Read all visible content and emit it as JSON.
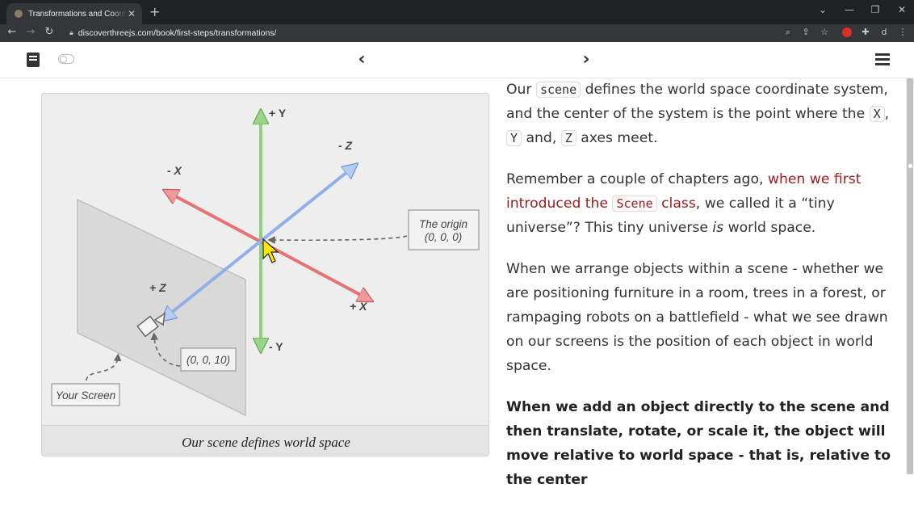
{
  "browser": {
    "tab_title": "Transformations and Coordinate",
    "tab_close": "✕",
    "new_tab": "+",
    "url": "discoverthreejs.com/book/first-steps/transformations/",
    "win_controls": {
      "list": "⌄",
      "minimize": "—",
      "restore": "❐",
      "close": "✕"
    },
    "profile_letter": "d"
  },
  "figure": {
    "labels": {
      "plus_y": "+ Y",
      "minus_y": "- Y",
      "plus_x": "+ X",
      "minus_x": "- X",
      "plus_z": "+ Z",
      "minus_z": "- Z"
    },
    "origin_label": [
      "The origin",
      "(0, 0, 0)"
    ],
    "camera_label": "(0, 0, 10)",
    "screen_label": "Your Screen",
    "caption": "Our scene defines world space",
    "colors": {
      "y_axis": "#8fd07a",
      "x_axis": "#e57373",
      "z_axis": "#8fb0e8"
    }
  },
  "content": {
    "p1": {
      "t1": "Our ",
      "c1": "scene",
      "t2": " defines the world space coordinate system, and the center of the system is the point where the ",
      "c2": "X",
      "t3": ", ",
      "c3": "Y",
      "t4": " and, ",
      "c4": "Z",
      "t5": " axes meet."
    },
    "p2": {
      "t1": "Remember a couple of chapters ago, ",
      "link1": "when we first introduced the ",
      "code": "Scene",
      "link2": " class",
      "t2": ", we called it a “tiny universe”? This tiny universe ",
      "em": "is",
      "t3": " world space."
    },
    "p3": "When we arrange objects within a scene - whether we are positioning furniture in a room, trees in a forest, or rampaging robots on a battlefield - what we see drawn on our screens is the position of each object in world space.",
    "p4": "When we add an object directly to the scene and then translate, rotate, or scale it, the object will move relative to world space - that is, relative to the center"
  }
}
